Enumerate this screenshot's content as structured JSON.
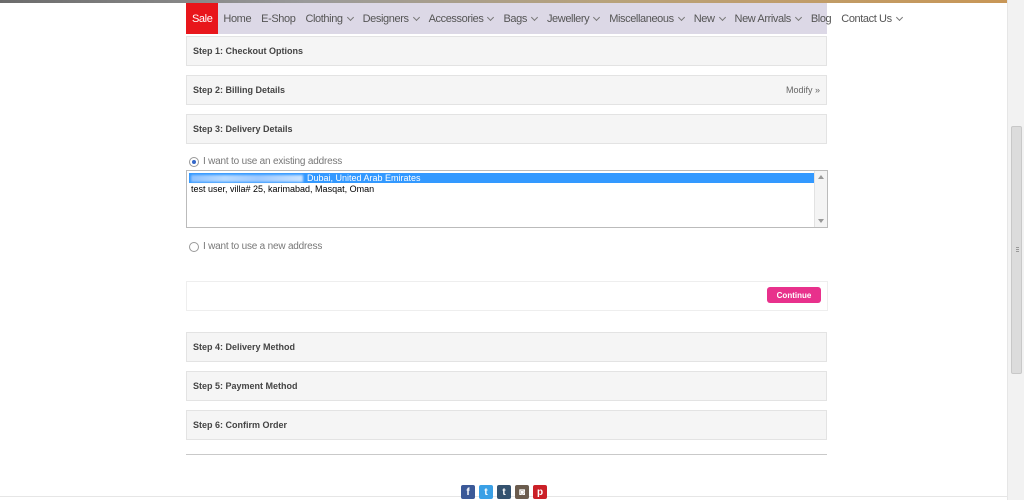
{
  "nav": {
    "items": [
      {
        "label": "Sale",
        "dropdown": false
      },
      {
        "label": "Home",
        "dropdown": false
      },
      {
        "label": "E-Shop",
        "dropdown": false
      },
      {
        "label": "Clothing",
        "dropdown": true
      },
      {
        "label": "Designers",
        "dropdown": true
      },
      {
        "label": "Accessories",
        "dropdown": true
      },
      {
        "label": "Bags",
        "dropdown": true
      },
      {
        "label": "Jewellery",
        "dropdown": true
      },
      {
        "label": "Miscellaneous",
        "dropdown": true
      },
      {
        "label": "New",
        "dropdown": true
      },
      {
        "label": "New Arrivals",
        "dropdown": true
      },
      {
        "label": "Blog",
        "dropdown": false
      },
      {
        "label": "Contact Us",
        "dropdown": true
      }
    ],
    "accent_color": "#e8161b"
  },
  "steps": {
    "step1": {
      "title": "Step 1: Checkout Options"
    },
    "step2": {
      "title": "Step 2: Billing Details",
      "modify": "Modify »"
    },
    "step3": {
      "title": "Step 3: Delivery Details"
    },
    "step4": {
      "title": "Step 4: Delivery Method"
    },
    "step5": {
      "title": "Step 5: Payment Method"
    },
    "step6": {
      "title": "Step 6: Confirm Order"
    }
  },
  "delivery": {
    "existing_label": "I want to use an existing address",
    "new_label": "I want to use a new address",
    "existing_checked": true,
    "addresses": [
      {
        "text": "Dubai, United Arab Emirates",
        "selected": true,
        "redacted_prefix": true
      },
      {
        "text": "test user, villa# 25, karimabad, Masqat, Oman",
        "selected": false
      }
    ]
  },
  "continue": {
    "label": "Continue",
    "color": "#e8318c"
  },
  "social": {
    "icons": [
      {
        "name": "facebook-icon",
        "glyph": "f"
      },
      {
        "name": "twitter-icon",
        "glyph": "t"
      },
      {
        "name": "tumblr-icon",
        "glyph": "t"
      },
      {
        "name": "instagram-icon",
        "glyph": "◙"
      },
      {
        "name": "pinterest-icon",
        "glyph": "p"
      }
    ]
  }
}
